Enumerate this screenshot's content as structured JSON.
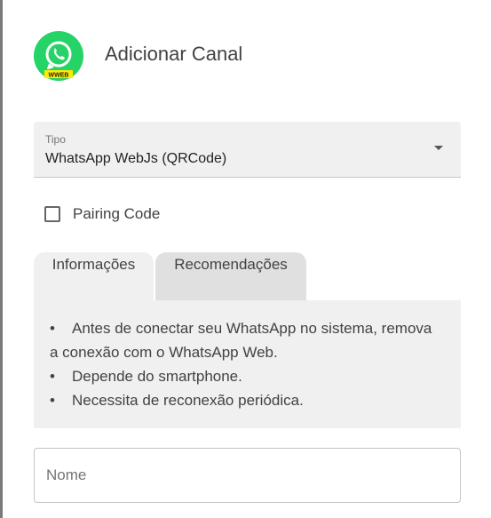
{
  "header": {
    "title": "Adicionar Canal",
    "logo_icon": "whatsapp-icon",
    "logo_badge": "WWEB",
    "brand_color": "#25d366"
  },
  "form": {
    "type_select": {
      "label": "Tipo",
      "value": "WhatsApp WebJs (QRCode)"
    },
    "pairing_checkbox": {
      "label": "Pairing Code",
      "checked": false
    },
    "tabs": [
      {
        "label": "Informações",
        "active": true
      },
      {
        "label": "Recomendações",
        "active": false
      }
    ],
    "info_items": [
      "Antes de conectar seu WhatsApp no sistema, remova a conexão com o WhatsApp Web.",
      "Depende do smartphone.",
      "Necessita de reconexão periódica."
    ],
    "bullet": "•",
    "name_input": {
      "placeholder": "Nome",
      "value": ""
    }
  }
}
